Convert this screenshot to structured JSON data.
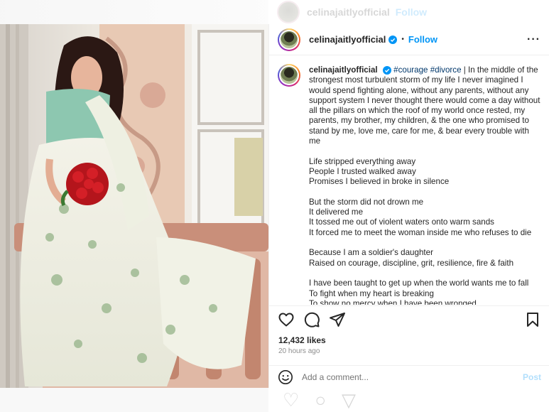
{
  "ghost": {
    "username": "celinajaitlyofficial",
    "follow_label": "Follow"
  },
  "header": {
    "username": "celinajaitlyofficial",
    "dot": "•",
    "follow_label": "Follow",
    "more_label": "···"
  },
  "caption": {
    "username": "celinajaitlyofficial",
    "hashtags": "#courage #divorce",
    "intro": "| In the middle of the strongest most turbulent storm of my life I never imagined I would spend fighting alone, without any parents, without any support system I never thought there would come a day without all the pillars on which the roof of my world once rested, my parents, my brother, my children, & the one who promised to stand by me, love me, care for me, & bear every trouble with me",
    "stanza1": [
      "Life stripped everything away",
      "People I trusted walked away",
      "Promises I believed in broke in silence"
    ],
    "stanza2": [
      "But the storm did not drown me",
      "It delivered me",
      "It tossed me out of violent waters onto warm sands",
      "It forced me to meet the woman inside me who refuses to die"
    ],
    "stanza3": [
      "Because I am a soldier's daughter",
      "Raised on courage, discipline, grit, resilience, fire & faith"
    ],
    "stanza4": [
      "I have been taught to get up when the world wants me to fall",
      "To fight when my heart is breaking",
      "To show no mercy when I have been wronged"
    ]
  },
  "stats": {
    "likes": "12,432 likes",
    "time_ago": "20 hours ago"
  },
  "comment": {
    "placeholder": "Add a comment...",
    "post_label": "Post"
  },
  "colors": {
    "accent": "#0095f6",
    "link": "#00376b",
    "muted": "#8e8e8e",
    "post_disabled": "#b2dffc"
  },
  "icons": [
    "heart-icon",
    "comment-icon",
    "share-icon",
    "bookmark-icon",
    "emoji-icon",
    "verified-icon",
    "more-icon"
  ]
}
